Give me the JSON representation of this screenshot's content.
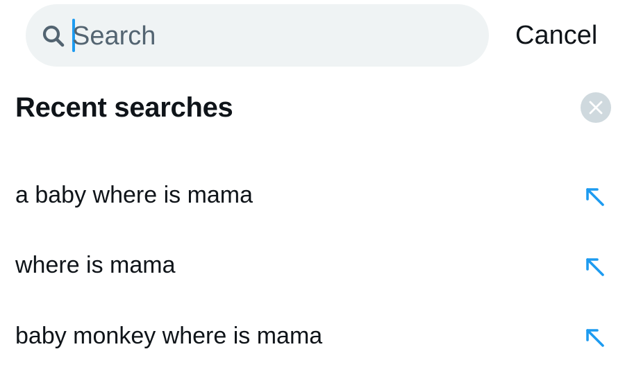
{
  "search": {
    "placeholder": "Search",
    "value": ""
  },
  "header": {
    "cancel_label": "Cancel"
  },
  "recent": {
    "title": "Recent searches",
    "items": [
      {
        "label": "a baby where is mama"
      },
      {
        "label": "where is mama"
      },
      {
        "label": "baby monkey where is mama"
      }
    ]
  },
  "colors": {
    "accent": "#1d9bf0",
    "search_background": "#eff3f4",
    "clear_button_background": "#cfd9de",
    "text_primary": "#0f1419",
    "placeholder": "#536471"
  },
  "icons": {
    "search": "search-icon",
    "clear": "close-icon",
    "fill_query": "arrow-up-left-icon"
  }
}
